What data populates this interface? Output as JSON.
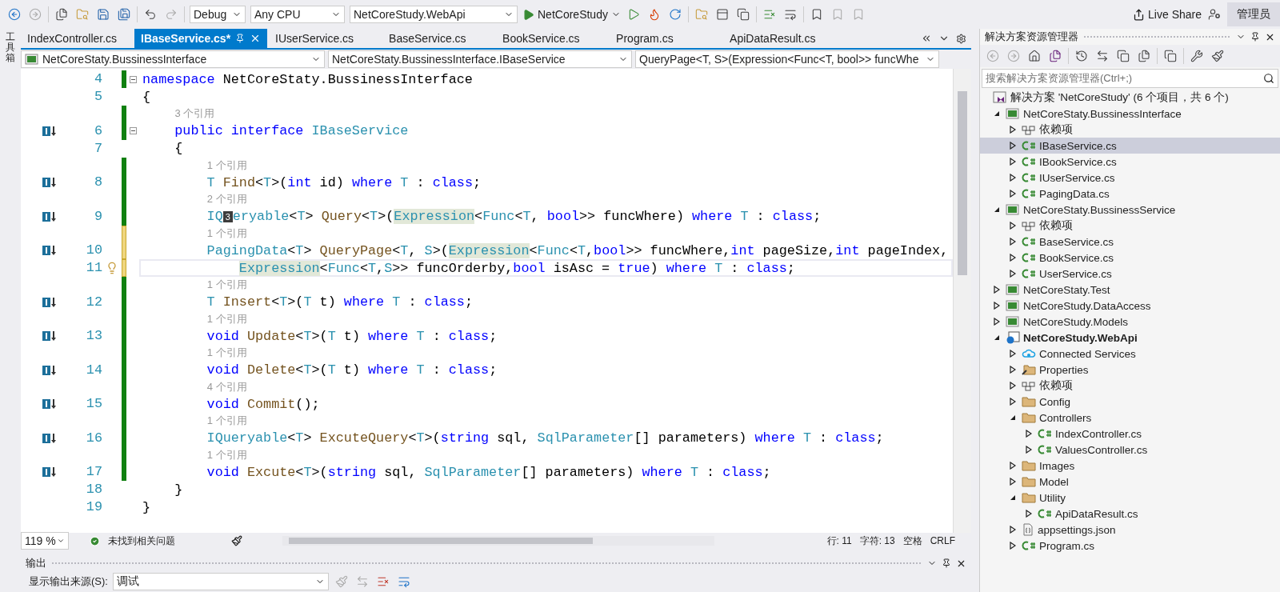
{
  "toolbar": {
    "configuration": "Debug",
    "platform": "Any CPU",
    "startup_project": "NetCoreStudy.WebApi",
    "run_target": "NetCoreStudy",
    "live_share": "Live Share",
    "user": "管理员"
  },
  "toolbox_strip": {
    "label": "工具箱"
  },
  "tabs": [
    {
      "label": "IndexController.cs",
      "selected": false
    },
    {
      "label": "IBaseService.cs*",
      "selected": true
    },
    {
      "label": "IUserService.cs",
      "selected": false
    },
    {
      "label": "BaseService.cs",
      "selected": false
    },
    {
      "label": "BookService.cs",
      "selected": false
    },
    {
      "label": "Program.cs",
      "selected": false
    },
    {
      "label": "ApiDataResult.cs",
      "selected": false
    }
  ],
  "navigation": {
    "project": "NetCoreStaty.BussinessInterface",
    "type": "NetCoreStaty.BussinessInterface.IBaseService",
    "member": "QueryPage<T, S>(Expression<Func<T, bool>> funcWhe"
  },
  "code": {
    "lines": [
      {
        "number": "4",
        "modified": true,
        "saved": true,
        "foldable": true,
        "implements": false,
        "current": false,
        "tokens": [
          {
            "t": "namespace",
            "color": "#0000ff"
          },
          {
            "t": " NetCoreStaty.BussinessInterface"
          }
        ]
      },
      {
        "number": "5",
        "modified": false,
        "foldable": false,
        "implements": false,
        "current": false,
        "tokens": [
          {
            "t": "{"
          }
        ]
      },
      {
        "number": "6",
        "lens": "3 个引用",
        "modified": true,
        "saved": true,
        "foldable": true,
        "implements": true,
        "current": false,
        "tokens": [
          {
            "t": "    public",
            "color": "#0000ff"
          },
          {
            "t": " interface",
            "color": "#0000ff"
          },
          {
            "t": " IBaseService",
            "color": "#2b91af"
          }
        ]
      },
      {
        "number": "7",
        "modified": false,
        "foldable": false,
        "implements": false,
        "current": false,
        "tokens": [
          {
            "t": "    {"
          }
        ]
      },
      {
        "number": "8",
        "lens": "1 个引用",
        "modified": true,
        "saved": true,
        "foldable": false,
        "implements": true,
        "current": false,
        "tokens": [
          {
            "t": "        T",
            "color": "#2b91af"
          },
          {
            "t": " Find",
            "color": "#74531f"
          },
          {
            "t": "<"
          },
          {
            "t": "T",
            "color": "#2b91af"
          },
          {
            "t": ">("
          },
          {
            "t": "int",
            "color": "#0000ff"
          },
          {
            "t": " id) "
          },
          {
            "t": "where",
            "color": "#0000ff"
          },
          {
            "t": " T",
            "color": "#2b91af"
          },
          {
            "t": " : "
          },
          {
            "t": "class",
            "color": "#0000ff"
          },
          {
            "t": ";"
          }
        ]
      },
      {
        "number": "9",
        "lens": "2 个引用",
        "modified": true,
        "saved": true,
        "foldable": false,
        "implements": true,
        "current": false,
        "tokens": [
          {
            "t": "        IQ",
            "color": "#2b91af"
          },
          {
            "badge": "3"
          },
          {
            "t": "eryable",
            "color": "#2b91af"
          },
          {
            "t": "<"
          },
          {
            "t": "T",
            "color": "#2b91af"
          },
          {
            "t": "> "
          },
          {
            "t": "Query",
            "color": "#74531f"
          },
          {
            "t": "<"
          },
          {
            "t": "T",
            "color": "#2b91af"
          },
          {
            "t": ">("
          },
          {
            "t": "Expression",
            "color": "#2b91af",
            "highlighted": true
          },
          {
            "t": "<"
          },
          {
            "t": "Func",
            "color": "#2b91af"
          },
          {
            "t": "<"
          },
          {
            "t": "T",
            "color": "#2b91af"
          },
          {
            "t": ", "
          },
          {
            "t": "bool",
            "color": "#0000ff"
          },
          {
            "t": ">> funcWhere) "
          },
          {
            "t": "where",
            "color": "#0000ff"
          },
          {
            "t": " T",
            "color": "#2b91af"
          },
          {
            "t": " : "
          },
          {
            "t": "class",
            "color": "#0000ff"
          },
          {
            "t": ";"
          }
        ]
      },
      {
        "number": "10",
        "lens": "1 个引用",
        "modified": true,
        "saved": false,
        "foldable": false,
        "implements": true,
        "current": false,
        "tokens": [
          {
            "t": "        PagingData",
            "color": "#2b91af"
          },
          {
            "t": "<"
          },
          {
            "t": "T",
            "color": "#2b91af"
          },
          {
            "t": "> "
          },
          {
            "t": "QueryPage",
            "color": "#74531f"
          },
          {
            "t": "<"
          },
          {
            "t": "T",
            "color": "#2b91af"
          },
          {
            "t": ", "
          },
          {
            "t": "S",
            "color": "#2b91af"
          },
          {
            "t": ">("
          },
          {
            "t": "Expression",
            "color": "#2b91af",
            "highlighted": true
          },
          {
            "t": "<"
          },
          {
            "t": "Func",
            "color": "#2b91af"
          },
          {
            "t": "<"
          },
          {
            "t": "T",
            "color": "#2b91af"
          },
          {
            "t": ","
          },
          {
            "t": "bool",
            "color": "#0000ff"
          },
          {
            "t": ">> funcWhere,"
          },
          {
            "t": "int",
            "color": "#0000ff"
          },
          {
            "t": " pageSize,"
          },
          {
            "t": "int",
            "color": "#0000ff"
          },
          {
            "t": " pageIndex,"
          }
        ]
      },
      {
        "number": "11",
        "modified": true,
        "saved": false,
        "foldable": false,
        "implements": false,
        "current": true,
        "lightbulb": true,
        "tokens": [
          {
            "t": "            Expression",
            "color": "#2b91af",
            "highlighted": true
          },
          {
            "t": "<"
          },
          {
            "t": "Func",
            "color": "#2b91af"
          },
          {
            "t": "<"
          },
          {
            "t": "T",
            "color": "#2b91af"
          },
          {
            "t": ","
          },
          {
            "t": "S",
            "color": "#2b91af"
          },
          {
            "t": ">> funcOrderby,"
          },
          {
            "t": "bool",
            "color": "#0000ff"
          },
          {
            "t": " isAsc = "
          },
          {
            "t": "true",
            "color": "#0000ff"
          },
          {
            "t": ") "
          },
          {
            "t": "where",
            "color": "#0000ff"
          },
          {
            "t": " T",
            "color": "#2b91af"
          },
          {
            "t": " : "
          },
          {
            "t": "class",
            "color": "#0000ff"
          },
          {
            "t": ";"
          }
        ]
      },
      {
        "number": "12",
        "lens": "1 个引用",
        "modified": true,
        "saved": true,
        "foldable": false,
        "implements": true,
        "current": false,
        "tokens": [
          {
            "t": "        T",
            "color": "#2b91af"
          },
          {
            "t": " Insert",
            "color": "#74531f"
          },
          {
            "t": "<"
          },
          {
            "t": "T",
            "color": "#2b91af"
          },
          {
            "t": ">("
          },
          {
            "t": "T",
            "color": "#2b91af"
          },
          {
            "t": " t) "
          },
          {
            "t": "where",
            "color": "#0000ff"
          },
          {
            "t": " T",
            "color": "#2b91af"
          },
          {
            "t": " : "
          },
          {
            "t": "class",
            "color": "#0000ff"
          },
          {
            "t": ";"
          }
        ]
      },
      {
        "number": "13",
        "lens": "1 个引用",
        "modified": true,
        "saved": true,
        "foldable": false,
        "implements": true,
        "current": false,
        "tokens": [
          {
            "t": "        void",
            "color": "#0000ff"
          },
          {
            "t": " Update",
            "color": "#74531f"
          },
          {
            "t": "<"
          },
          {
            "t": "T",
            "color": "#2b91af"
          },
          {
            "t": ">("
          },
          {
            "t": "T",
            "color": "#2b91af"
          },
          {
            "t": " t) "
          },
          {
            "t": "where",
            "color": "#0000ff"
          },
          {
            "t": " T",
            "color": "#2b91af"
          },
          {
            "t": " : "
          },
          {
            "t": "class",
            "color": "#0000ff"
          },
          {
            "t": ";"
          }
        ]
      },
      {
        "number": "14",
        "lens": "1 个引用",
        "modified": true,
        "saved": true,
        "foldable": false,
        "implements": true,
        "current": false,
        "tokens": [
          {
            "t": "        void",
            "color": "#0000ff"
          },
          {
            "t": " Delete",
            "color": "#74531f"
          },
          {
            "t": "<"
          },
          {
            "t": "T",
            "color": "#2b91af"
          },
          {
            "t": ">("
          },
          {
            "t": "T",
            "color": "#2b91af"
          },
          {
            "t": " t) "
          },
          {
            "t": "where",
            "color": "#0000ff"
          },
          {
            "t": " T",
            "color": "#2b91af"
          },
          {
            "t": " : "
          },
          {
            "t": "class",
            "color": "#0000ff"
          },
          {
            "t": ";"
          }
        ]
      },
      {
        "number": "15",
        "lens": "4 个引用",
        "modified": true,
        "saved": true,
        "foldable": false,
        "implements": true,
        "current": false,
        "tokens": [
          {
            "t": "        void",
            "color": "#0000ff"
          },
          {
            "t": " Commit",
            "color": "#74531f"
          },
          {
            "t": "();"
          }
        ]
      },
      {
        "number": "16",
        "lens": "1 个引用",
        "modified": true,
        "saved": true,
        "foldable": false,
        "implements": true,
        "current": false,
        "tokens": [
          {
            "t": "        IQueryable",
            "color": "#2b91af"
          },
          {
            "t": "<"
          },
          {
            "t": "T",
            "color": "#2b91af"
          },
          {
            "t": "> "
          },
          {
            "t": "ExcuteQuery",
            "color": "#74531f"
          },
          {
            "t": "<"
          },
          {
            "t": "T",
            "color": "#2b91af"
          },
          {
            "t": ">("
          },
          {
            "t": "string",
            "color": "#0000ff"
          },
          {
            "t": " sql, "
          },
          {
            "t": "SqlParameter",
            "color": "#2b91af"
          },
          {
            "t": "[] parameters) "
          },
          {
            "t": "where",
            "color": "#0000ff"
          },
          {
            "t": " T",
            "color": "#2b91af"
          },
          {
            "t": " : "
          },
          {
            "t": "class",
            "color": "#0000ff"
          },
          {
            "t": ";"
          }
        ]
      },
      {
        "number": "17",
        "lens": "1 个引用",
        "modified": true,
        "saved": true,
        "foldable": false,
        "implements": true,
        "current": false,
        "tokens": [
          {
            "t": "        void",
            "color": "#0000ff"
          },
          {
            "t": " Excute",
            "color": "#74531f"
          },
          {
            "t": "<"
          },
          {
            "t": "T",
            "color": "#2b91af"
          },
          {
            "t": ">("
          },
          {
            "t": "string",
            "color": "#0000ff"
          },
          {
            "t": " sql, "
          },
          {
            "t": "SqlParameter",
            "color": "#2b91af"
          },
          {
            "t": "[] parameters) "
          },
          {
            "t": "where",
            "color": "#0000ff"
          },
          {
            "t": " T",
            "color": "#2b91af"
          },
          {
            "t": " : "
          },
          {
            "t": "class",
            "color": "#0000ff"
          },
          {
            "t": ";"
          }
        ]
      },
      {
        "number": "18",
        "modified": false,
        "foldable": false,
        "implements": false,
        "current": false,
        "tokens": [
          {
            "t": "    }"
          }
        ]
      },
      {
        "number": "19",
        "modified": false,
        "foldable": false,
        "implements": false,
        "current": false,
        "tokens": [
          {
            "t": "}"
          }
        ]
      }
    ]
  },
  "editor_status": {
    "zoom": "119 %",
    "issues": "未找到相关问题",
    "line": "行: 11",
    "char": "字符: 13",
    "spacing": "空格",
    "line_ending": "CRLF"
  },
  "output": {
    "title": "输出",
    "source_label": "显示输出来源(S):",
    "source": "调试"
  },
  "solution_explorer": {
    "title": "解决方案资源管理器",
    "search_placeholder": "搜索解决方案资源管理器(Ctrl+;)",
    "tree": [
      {
        "label": "解决方案 'NetCoreStudy' (6 个项目，共 6 个)",
        "kind": "solution",
        "selected": false,
        "children": [
          {
            "label": "NetCoreStaty.BussinessInterface",
            "kind": "project",
            "expanded": true,
            "selected": false,
            "children": [
              {
                "label": "依赖项",
                "kind": "deps",
                "expanded": false,
                "selected": false
              },
              {
                "label": "IBaseService.cs",
                "kind": "cs",
                "expanded": false,
                "selected": true
              },
              {
                "label": "IBookService.cs",
                "kind": "cs",
                "expanded": false,
                "selected": false
              },
              {
                "label": "IUserService.cs",
                "kind": "cs",
                "expanded": false,
                "selected": false
              },
              {
                "label": "PagingData.cs",
                "kind": "cs",
                "expanded": false,
                "selected": false
              }
            ]
          },
          {
            "label": "NetCoreStaty.BussinessService",
            "kind": "project",
            "expanded": true,
            "selected": false,
            "children": [
              {
                "label": "依赖项",
                "kind": "deps",
                "expanded": false,
                "selected": false
              },
              {
                "label": "BaseService.cs",
                "kind": "cs",
                "expanded": false,
                "selected": false
              },
              {
                "label": "BookService.cs",
                "kind": "cs",
                "expanded": false,
                "selected": false
              },
              {
                "label": "UserService.cs",
                "kind": "cs",
                "expanded": false,
                "selected": false
              }
            ]
          },
          {
            "label": "NetCoreStaty.Test",
            "kind": "project",
            "expanded": false,
            "selected": false
          },
          {
            "label": "NetCoreStudy.DataAccess",
            "kind": "project",
            "expanded": false,
            "selected": false
          },
          {
            "label": "NetCoreStudy.Models",
            "kind": "project",
            "expanded": false,
            "selected": false
          },
          {
            "label": "NetCoreStudy.WebApi",
            "kind": "webproject",
            "startup": true,
            "expanded": true,
            "selected": false,
            "children": [
              {
                "label": "Connected Services",
                "kind": "cloud",
                "expanded": false,
                "selected": false
              },
              {
                "label": "Properties",
                "kind": "properties",
                "expanded": false,
                "selected": false
              },
              {
                "label": "依赖项",
                "kind": "deps",
                "expanded": false,
                "selected": false
              },
              {
                "label": "Config",
                "kind": "folder",
                "expanded": false,
                "selected": false
              },
              {
                "label": "Controllers",
                "kind": "folder",
                "expanded": true,
                "selected": false,
                "children": [
                  {
                    "label": "IndexController.cs",
                    "kind": "cs",
                    "expanded": false,
                    "selected": false
                  },
                  {
                    "label": "ValuesController.cs",
                    "kind": "cs",
                    "expanded": false,
                    "selected": false
                  }
                ]
              },
              {
                "label": "Images",
                "kind": "folder",
                "expanded": false,
                "selected": false
              },
              {
                "label": "Model",
                "kind": "folder",
                "expanded": false,
                "selected": false
              },
              {
                "label": "Utility",
                "kind": "folder",
                "expanded": true,
                "selected": false,
                "children": [
                  {
                    "label": "ApiDataResult.cs",
                    "kind": "cs",
                    "expanded": false,
                    "selected": false
                  }
                ]
              },
              {
                "label": "appsettings.json",
                "kind": "json",
                "expanded": false,
                "selected": false
              },
              {
                "label": "Program.cs",
                "kind": "cs",
                "expanded": false,
                "selected": false
              }
            ]
          }
        ]
      }
    ]
  }
}
